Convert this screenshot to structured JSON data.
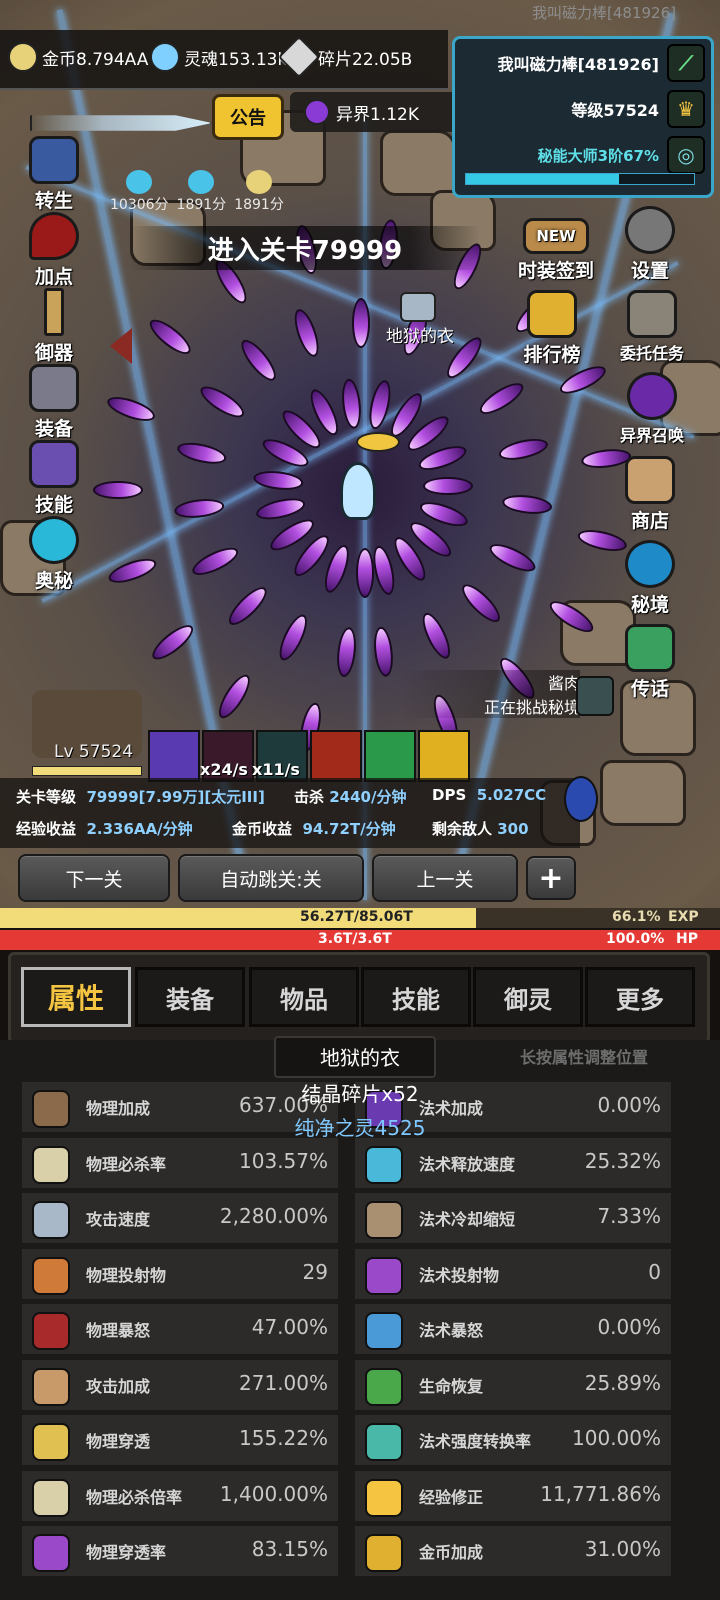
{
  "watermark": "我叫磁力棒[481926]",
  "resources": {
    "gold": "金币8.794AA",
    "soul": "灵魂153.13k",
    "shard": "碎片22.05B",
    "otherworld": "异界1.12K",
    "notice": "公告"
  },
  "player": {
    "name": "我叫磁力棒[481926]",
    "level": "等级57524",
    "title": "秘能大师3阶67%",
    "title_progress": 0.67
  },
  "buffs": [
    "10306分",
    "1891分",
    "1891分"
  ],
  "stage_banner": "进入关卡79999",
  "drop_item_label": "地狱的衣",
  "left_menu": [
    "转生",
    "加点",
    "御器",
    "装备",
    "技能",
    "奥秘"
  ],
  "right_menu": [
    "时装签到",
    "设置",
    "排行榜",
    "委托任务",
    "异界召唤",
    "商店",
    "秘境",
    "传话"
  ],
  "new_badge": "NEW",
  "challenge": {
    "name": "酱肉",
    "status": "正在挑战秘境"
  },
  "pet_level": "Lv 57524",
  "skill_rates": [
    "x24/s",
    "x11/s"
  ],
  "stats": {
    "stage_level_label": "关卡等级",
    "stage_level_value": "79999[7.99万][太元III]",
    "kills_label": "击杀",
    "kills_value": "2440/分钟",
    "dps_label": "DPS",
    "dps_value": "5.027CC",
    "exp_label": "经验收益",
    "exp_value": "2.336AA/分钟",
    "gold_label": "金币收益",
    "gold_value": "94.72T/分钟",
    "enemies_label": "剩余敌人",
    "enemies_value": "300"
  },
  "buttons": {
    "next": "下一关",
    "auto": "自动跳关:关",
    "prev": "上一关",
    "plus": "+"
  },
  "exp_bar": {
    "text": "56.27T/85.06T",
    "percent": "66.1%",
    "label": "EXP",
    "fraction": 0.661
  },
  "hp_bar": {
    "text": "3.6T/3.6T",
    "percent": "100.0%",
    "label": "HP",
    "fraction": 1.0
  },
  "tabs": [
    "属性",
    "装备",
    "物品",
    "技能",
    "御灵",
    "更多"
  ],
  "long_press_hint": "长按属性调整位置",
  "tooltip": {
    "title": "地狱的衣",
    "line1": "结晶碎片x52",
    "line2": "纯净之灵4525"
  },
  "attributes_left": [
    {
      "name": "物理加成",
      "value": "637.00%"
    },
    {
      "name": "物理必杀率",
      "value": "103.57%"
    },
    {
      "name": "攻击速度",
      "value": "2,280.00%"
    },
    {
      "name": "物理投射物",
      "value": "29"
    },
    {
      "name": "物理暴怒",
      "value": "47.00%"
    },
    {
      "name": "攻击加成",
      "value": "271.00%"
    },
    {
      "name": "物理穿透",
      "value": "155.22%"
    },
    {
      "name": "物理必杀倍率",
      "value": "1,400.00%"
    },
    {
      "name": "物理穿透率",
      "value": "83.15%"
    }
  ],
  "attributes_right": [
    {
      "name": "法术加成",
      "value": "0.00%"
    },
    {
      "name": "法术释放速度",
      "value": "25.32%"
    },
    {
      "name": "法术冷却缩短",
      "value": "7.33%"
    },
    {
      "name": "法术投射物",
      "value": "0"
    },
    {
      "name": "法术暴怒",
      "value": "0.00%"
    },
    {
      "name": "生命恢复",
      "value": "25.89%"
    },
    {
      "name": "法术强度转换率",
      "value": "100.00%"
    },
    {
      "name": "经验修正",
      "value": "11,771.86%"
    },
    {
      "name": "金币加成",
      "value": "31.00%"
    }
  ],
  "colors": {
    "exp_fill": "#f2dc7a",
    "hp_fill": "#e53935",
    "accent_gold": "#f5c542",
    "stat_value": "#8fd0ff"
  }
}
